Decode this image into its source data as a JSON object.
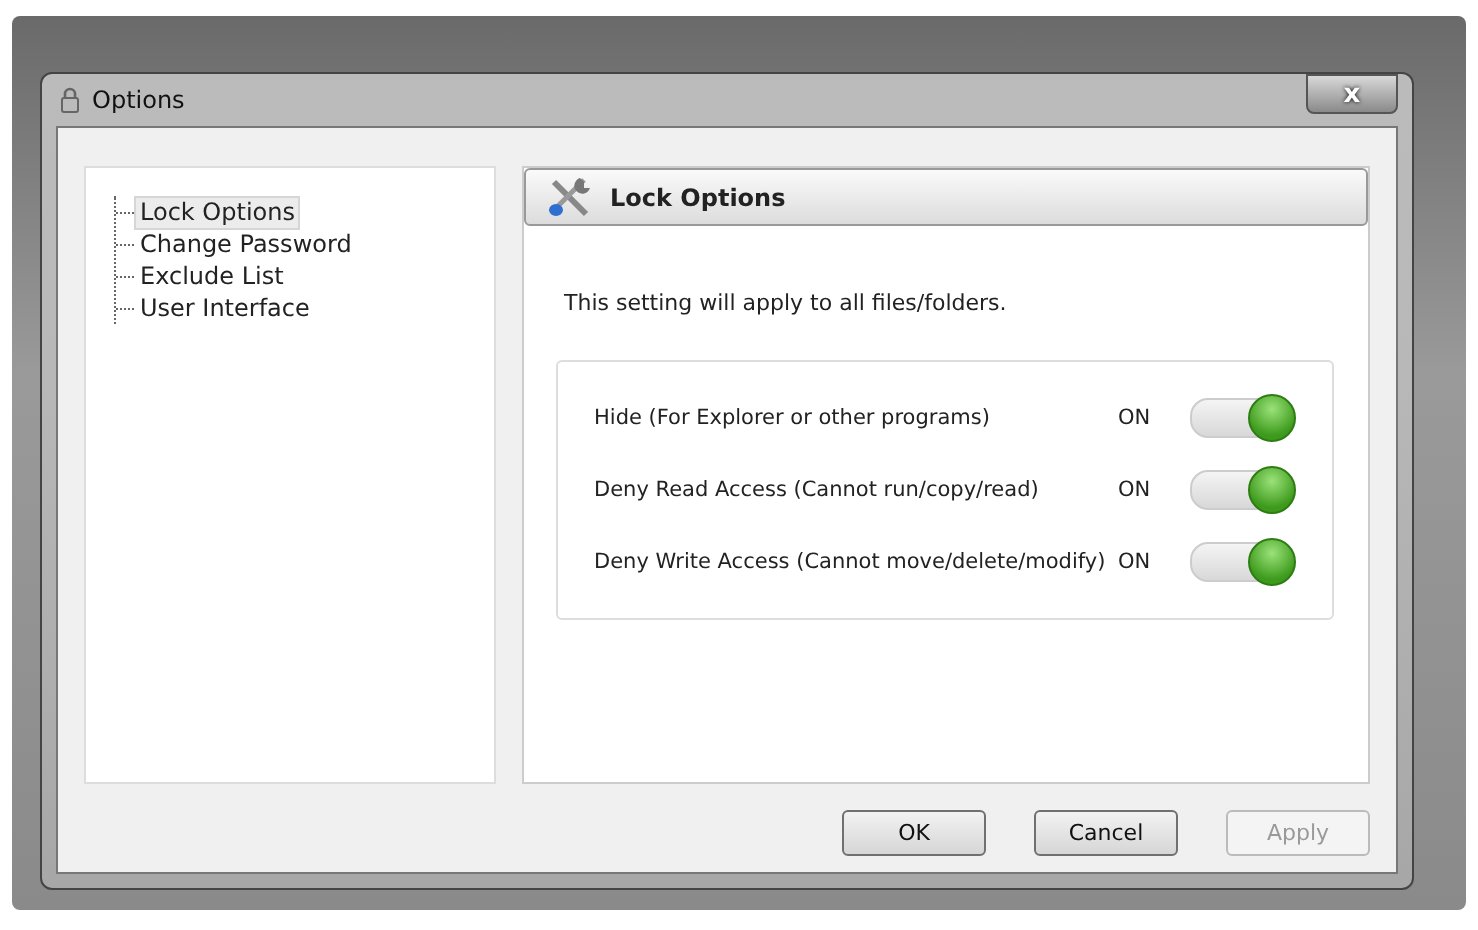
{
  "window": {
    "title": "Options",
    "close": "x"
  },
  "sidebar": {
    "items": [
      {
        "label": "Lock Options",
        "selected": true
      },
      {
        "label": "Change Password",
        "selected": false
      },
      {
        "label": "Exclude List",
        "selected": false
      },
      {
        "label": "User Interface",
        "selected": false
      }
    ]
  },
  "panel": {
    "title": "Lock Options",
    "description": "This setting will apply to all files/folders.",
    "settings": [
      {
        "label": "Hide (For Explorer or other programs)",
        "status": "ON",
        "on": true
      },
      {
        "label": "Deny Read Access (Cannot run/copy/read)",
        "status": "ON",
        "on": true
      },
      {
        "label": "Deny Write Access (Cannot move/delete/modify)",
        "status": "ON",
        "on": true
      }
    ]
  },
  "buttons": [
    {
      "label": "OK",
      "disabled": false
    },
    {
      "label": "Cancel",
      "disabled": false
    },
    {
      "label": "Apply",
      "disabled": true
    }
  ]
}
